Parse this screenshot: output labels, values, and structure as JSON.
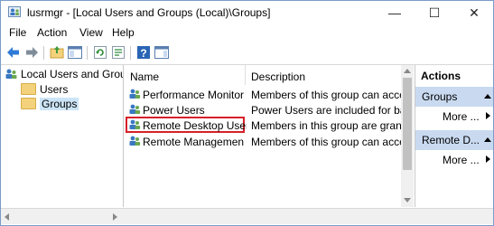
{
  "window": {
    "title": "lusrmgr - [Local Users and Groups (Local)\\Groups]",
    "minimize_icon": "minimize-icon",
    "maximize_icon": "maximize-icon",
    "close_icon": "close-icon",
    "minimize_glyph": "—",
    "maximize_glyph": "☐",
    "close_glyph": "✕"
  },
  "menu": {
    "file": "File",
    "action": "Action",
    "view": "View",
    "help": "Help"
  },
  "tree": {
    "root": "Local Users and Groups (Local)",
    "users": "Users",
    "groups": "Groups"
  },
  "list": {
    "headers": {
      "name": "Name",
      "description": "Description"
    },
    "rows": [
      {
        "name": "Performance Monitor Users",
        "description": "Members of this group can access performance counter data"
      },
      {
        "name": "Power Users",
        "description": "Power Users are included for backwards compatibility"
      },
      {
        "name": "Remote Desktop Users",
        "description": "Members in this group are granted the right to logon remotely"
      },
      {
        "name": "Remote Management Users",
        "description": "Members of this group can access WMI resources"
      }
    ]
  },
  "actions": {
    "header": "Actions",
    "section1": "Groups",
    "section1_more": "More ...",
    "section2": "Remote D...",
    "section2_more": "More ..."
  },
  "colors": {
    "accent": "#c9daf0",
    "selection_border": "#d6202a",
    "folder": "#f4d27b"
  }
}
